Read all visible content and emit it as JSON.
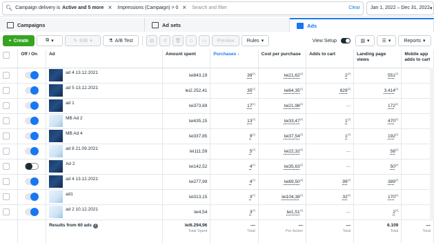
{
  "filters": {
    "chip1_prefix": "Campaign delivery is ",
    "chip1_bold": "Active and 5 more",
    "chip2": "Impressions (Campaign) > 0",
    "search_placeholder": "Search and filter",
    "clear_label": "Clear",
    "date_range": "Jan 1, 2022 – Dec 31, 2022"
  },
  "tabs": [
    {
      "label": "Campaigns"
    },
    {
      "label": "Ad sets"
    },
    {
      "label": "Ads"
    }
  ],
  "toolbar": {
    "create": "Create",
    "edit": "Edit",
    "ab_test": "A/B Test",
    "preview": "Preview",
    "rules": "Rules",
    "view_setup": "View Setup",
    "reports": "Reports"
  },
  "columns": {
    "onoff": "Off / On",
    "ad": "Ad",
    "amount": "Amount spent",
    "purchases": "Purchases ↓",
    "cpp": "Cost per purchase",
    "atc": "Adds to cart",
    "lpv": "Landing page views",
    "mobile": "Mobile app adds to cart"
  },
  "rows": [
    {
      "name": "ad 4 13.12.2021",
      "on": true,
      "thumb": "dark",
      "amount": "lei843,19",
      "purchases": "39",
      "cpp": "lei21,62",
      "atc": "2",
      "lpv": "551"
    },
    {
      "name": "ad 5 13.12.2021",
      "on": true,
      "thumb": "dark",
      "amount": "lei2.252,41",
      "purchases": "35",
      "cpp": "lei64,35",
      "atc": "829",
      "lpv": "3.414"
    },
    {
      "name": "ad 1",
      "on": true,
      "thumb": "dark",
      "amount": "lei373,69",
      "purchases": "17",
      "cpp": "lei21,98",
      "atc": "—",
      "lpv": "172"
    },
    {
      "name": "MB Ad 2",
      "on": true,
      "thumb": "light",
      "amount": "lei435,15",
      "purchases": "13",
      "cpp": "lei33,47",
      "atc": "1",
      "lpv": "470"
    },
    {
      "name": "MB Ad 4",
      "on": true,
      "thumb": "dark",
      "amount": "lei337,85",
      "purchases": "9",
      "cpp": "lei37,54",
      "atc": "1",
      "lpv": "192"
    },
    {
      "name": "ad 8 21.09.2021",
      "on": true,
      "thumb": "light",
      "amount": "lei111,59",
      "purchases": "5",
      "cpp": "lei22,32",
      "atc": "—",
      "lpv": "58"
    },
    {
      "name": "Ad 2",
      "on": false,
      "thumb": "dark",
      "amount": "lei142,52",
      "purchases": "4",
      "cpp": "lei35,63",
      "atc": "—",
      "lpv": "50"
    },
    {
      "name": "ad 4 13.12.2021",
      "on": true,
      "thumb": "dark",
      "amount": "lei277,99",
      "purchases": "4",
      "cpp": "lei69,50",
      "atc": "99",
      "lpv": "389"
    },
    {
      "name": "ad1",
      "on": true,
      "thumb": "light",
      "amount": "lei313,15",
      "purchases": "3",
      "cpp": "lei104,38",
      "atc": "32",
      "lpv": "170"
    },
    {
      "name": "ad 2 10.12.2021",
      "on": true,
      "thumb": "light",
      "amount": "lei4,54",
      "purchases": "3",
      "cpp": "lei1,51",
      "atc": "—",
      "lpv": "2"
    }
  ],
  "summary": {
    "results_label": "Results from 60 ads",
    "amount": "lei6.294,96",
    "amount_label": "Total Spent",
    "purchases": "—",
    "purchases_label": "Total",
    "cpp": "—",
    "cpp_label": "Per Action",
    "atc": "—",
    "atc_label": "Total",
    "lpv": "6.109",
    "lpv_label": "Total",
    "mobile": "—",
    "mobile_label": "Total"
  },
  "colors": {
    "accent": "#1877f2",
    "create": "#36a420"
  }
}
